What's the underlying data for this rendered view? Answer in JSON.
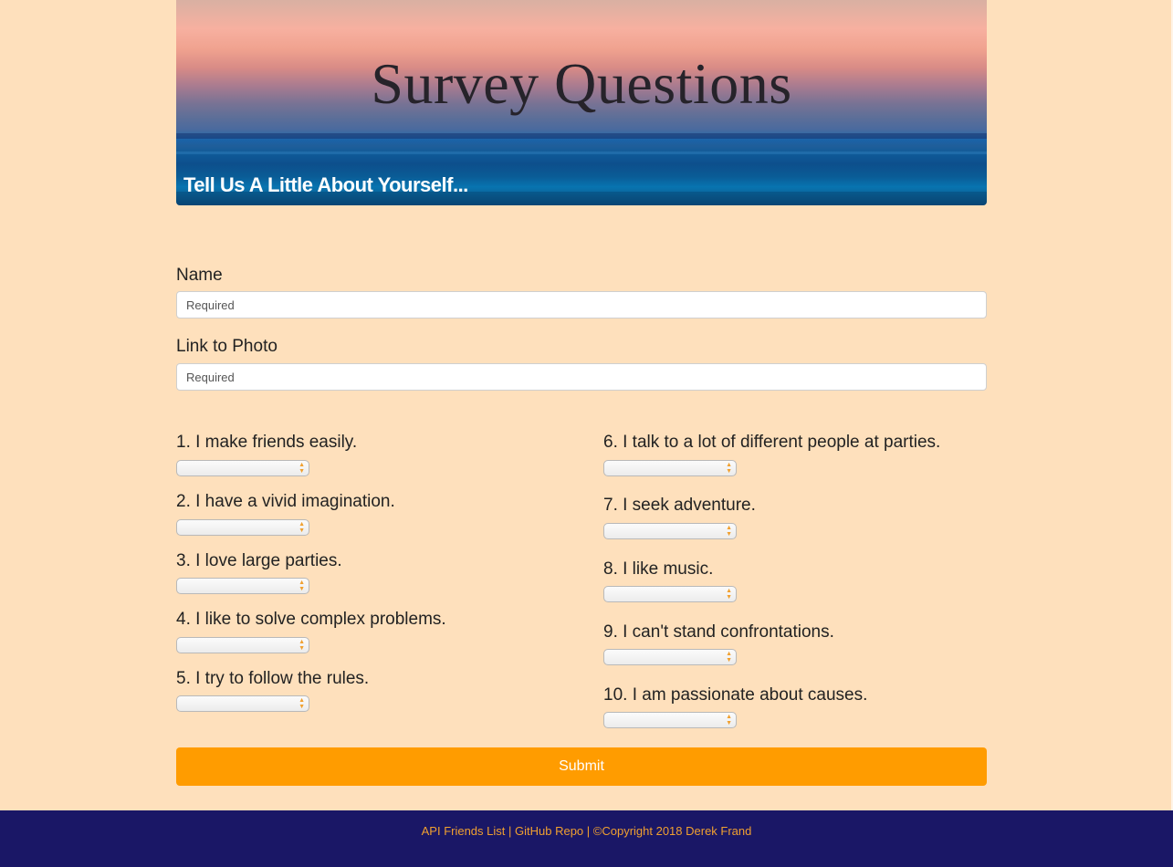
{
  "header": {
    "title": "Survey Questions",
    "subtitle": "Tell Us A Little About Yourself..."
  },
  "form": {
    "name_label": "Name",
    "name_placeholder": "Required",
    "photo_label": "Link to Photo",
    "photo_placeholder": "Required",
    "questions": [
      "1.  I make friends easily.",
      "2.  I have a vivid imagination.",
      "3.  I love large parties.",
      "4.  I like to solve complex problems.",
      "5.  I try to follow the rules.",
      "6.  I talk to a lot of different people at parties.",
      "7.  I seek adventure.",
      "8.  I like music.",
      "9.  I can't stand confrontations.",
      "10.  I am passionate about causes."
    ],
    "submit_label": "Submit"
  },
  "footer": {
    "link_friends": "API Friends List",
    "sep1": " | ",
    "link_repo": "GitHub Repo",
    "sep2": " | ",
    "copyright": "©Copyright 2018 Derek Frand"
  },
  "colors": {
    "background": "#fee0bc",
    "accent": "#ff9c00",
    "footer": "#1a1766"
  }
}
